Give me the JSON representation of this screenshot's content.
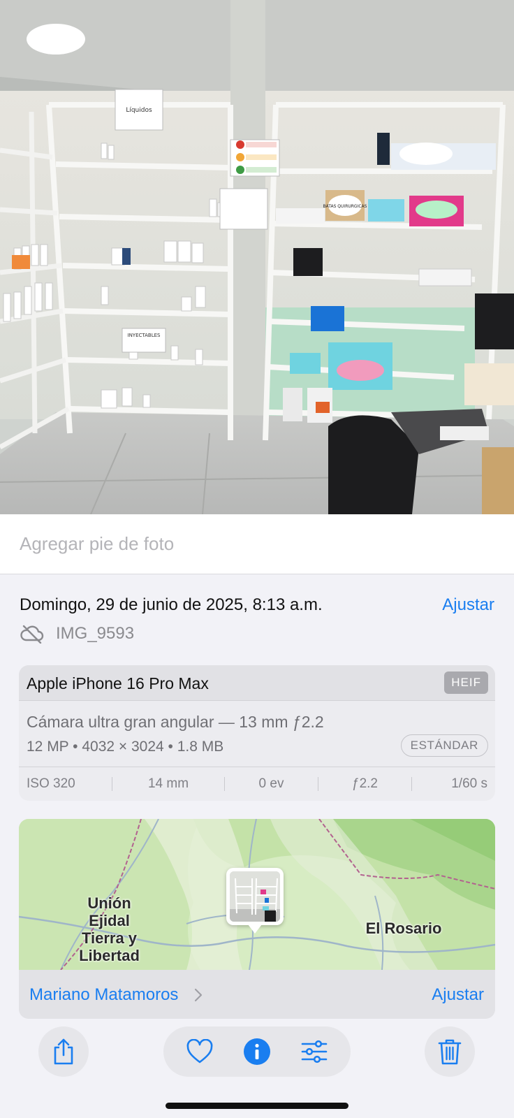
{
  "caption": {
    "placeholder": "Agregar pie de foto"
  },
  "info": {
    "date": "Domingo, 29 de junio de 2025, 8:13 a.m.",
    "adjust_date_label": "Ajustar",
    "file_name": "IMG_9593",
    "cloud_status_icon": "icloud-slash-icon"
  },
  "camera": {
    "device": "Apple iPhone 16 Pro Max",
    "format": "HEIF",
    "lens": "Cámara ultra gran angular — 13 mm ƒ2.2",
    "specs": "12 MP • 4032 × 3024 • 1.8 MB",
    "mode": "ESTÁNDAR",
    "exif": {
      "iso": "ISO 320",
      "focal": "14 mm",
      "ev": "0 ev",
      "aperture": "ƒ2.2",
      "shutter": "1/60 s"
    }
  },
  "map": {
    "labels": {
      "left_line1": "Unión",
      "left_line2": "Ejidal",
      "left_line3": "Tierra y",
      "left_line4": "Libertad",
      "right": "El Rosario"
    },
    "location_name": "Mariano Matamoros",
    "adjust_location_label": "Ajustar"
  },
  "photo_signs": {
    "liquidos": "Líquidos",
    "inyectables": "INYECTABLES",
    "batas": "BATAS QUIRURGICAS"
  },
  "toolbar": {
    "share_icon": "share-icon",
    "favorite_icon": "heart-icon",
    "info_icon": "info-icon",
    "edit_icon": "sliders-icon",
    "delete_icon": "trash-icon"
  },
  "colors": {
    "accent": "#1a7ef0",
    "background": "#f2f2f7",
    "card": "#ececf0"
  }
}
